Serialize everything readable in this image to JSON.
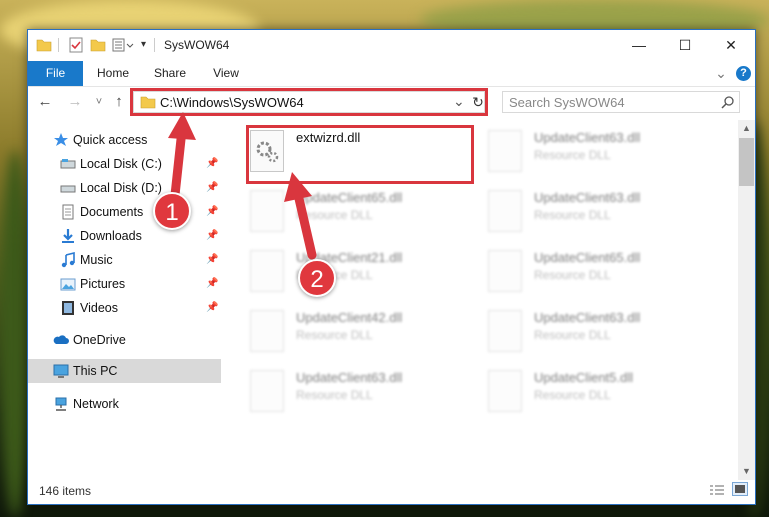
{
  "window": {
    "title": "SysWOW64",
    "minimize_glyph": "—",
    "maximize_glyph": "☐",
    "close_glyph": "✕"
  },
  "ribbon": {
    "tabs": [
      "File",
      "Home",
      "Share",
      "View"
    ],
    "expand_glyph": "⌄",
    "help_glyph": "?"
  },
  "nav": {
    "back_glyph": "←",
    "forward_glyph": "→",
    "recent_glyph": "˅",
    "up_glyph": "↑",
    "address": "C:\\Windows\\SysWOW64",
    "address_dropdown_glyph": "⌄",
    "refresh_glyph": "↻",
    "search_placeholder": "Search SysWOW64"
  },
  "sidebar": {
    "items": [
      {
        "label": "Quick access",
        "icon": "star-icon",
        "pinned": false
      },
      {
        "label": "Local Disk (C:)",
        "icon": "drive-icon",
        "pinned": true
      },
      {
        "label": "Local Disk (D:)",
        "icon": "drive-icon",
        "pinned": true
      },
      {
        "label": "Documents",
        "icon": "documents-icon",
        "pinned": true
      },
      {
        "label": "Downloads",
        "icon": "download-icon",
        "pinned": true
      },
      {
        "label": "Music",
        "icon": "music-icon",
        "pinned": true
      },
      {
        "label": "Pictures",
        "icon": "pictures-icon",
        "pinned": true
      },
      {
        "label": "Videos",
        "icon": "videos-icon",
        "pinned": true
      },
      {
        "label": "OneDrive",
        "icon": "cloud-icon",
        "pinned": false
      },
      {
        "label": "This PC",
        "icon": "computer-icon",
        "pinned": false,
        "selected": true
      },
      {
        "label": "Network",
        "icon": "network-icon",
        "pinned": false
      }
    ]
  },
  "files": [
    {
      "name": "extwizrd.dll",
      "type": "",
      "highlighted": true
    },
    {
      "name": "UpdateClient63.dll",
      "type": "Resource DLL"
    },
    {
      "name": "UpdateClient65.dll",
      "type": "Resource DLL"
    },
    {
      "name": "UpdateClient63.dll",
      "type": "Resource DLL"
    },
    {
      "name": "UpdateClient21.dll",
      "type": "Resource DLL"
    },
    {
      "name": "UpdateClient65.dll",
      "type": "Resource DLL"
    },
    {
      "name": "UpdateClient42.dll",
      "type": "Resource DLL"
    },
    {
      "name": "UpdateClient63.dll",
      "type": "Resource DLL"
    },
    {
      "name": "UpdateClient63.dll",
      "type": "Resource DLL"
    },
    {
      "name": "UpdateClient5.dll",
      "type": "Resource DLL"
    }
  ],
  "status": {
    "item_count": "146 items"
  },
  "annotations": {
    "step1": "1",
    "step2": "2"
  },
  "colors": {
    "accent": "#1979ca",
    "highlight_red": "#d9363e"
  }
}
